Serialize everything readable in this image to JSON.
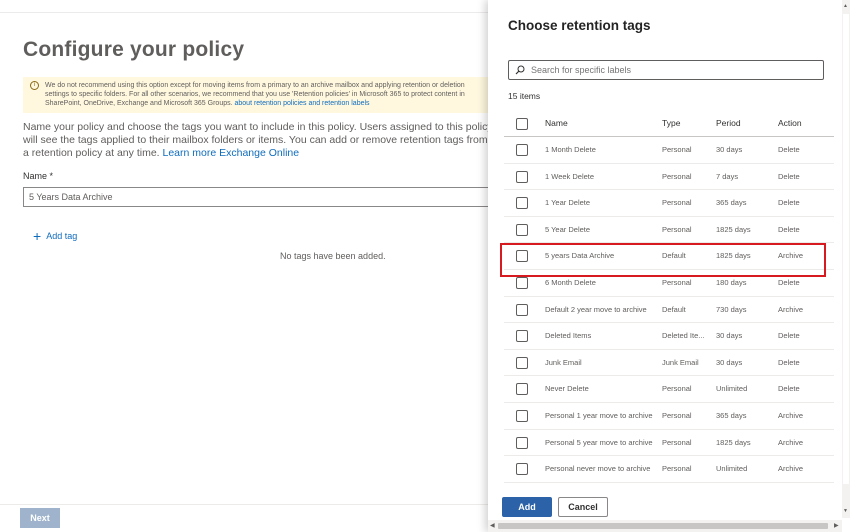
{
  "background": {
    "title": "Configure your policy",
    "warning": "We do not recommend using this option except for moving items from a primary to an archive mailbox and applying retention or deletion settings to specific folders. For all other scenarios, we recommend that you use 'Retention policies' in Microsoft 365 to protect content in SharePoint, OneDrive, Exchange and Microsoft 365 Groups.",
    "warning_link": "about retention policies and retention labels",
    "description": "Name your policy and choose the tags you want to include in this policy. Users assigned to this policy will see the tags applied to their mailbox folders or items. You can add or remove retention tags from a retention policy at any time.",
    "description_link_1": "Learn more",
    "description_link_2": "Exchange Online",
    "name_label": "Name *",
    "name_value": "5 Years Data Archive",
    "add_tag": "Add tag",
    "no_tags": "No tags have been added.",
    "next_button": "Next"
  },
  "panel": {
    "title": "Choose retention tags",
    "search_placeholder": "Search for specific labels",
    "count": "15 items",
    "headers": {
      "name": "Name",
      "type": "Type",
      "period": "Period",
      "action": "Action"
    },
    "rows": [
      {
        "name": "1 Month Delete",
        "type": "Personal",
        "period": "30 days",
        "action": "Delete"
      },
      {
        "name": "1 Week Delete",
        "type": "Personal",
        "period": "7 days",
        "action": "Delete"
      },
      {
        "name": "1 Year Delete",
        "type": "Personal",
        "period": "365 days",
        "action": "Delete"
      },
      {
        "name": "5 Year Delete",
        "type": "Personal",
        "period": "1825 days",
        "action": "Delete"
      },
      {
        "name": "5 years Data Archive",
        "type": "Default",
        "period": "1825 days",
        "action": "Archive"
      },
      {
        "name": "6 Month Delete",
        "type": "Personal",
        "period": "180 days",
        "action": "Delete"
      },
      {
        "name": "Default 2 year move to archive",
        "type": "Default",
        "period": "730 days",
        "action": "Archive"
      },
      {
        "name": "Deleted Items",
        "type": "Deleted Ite...",
        "period": "30 days",
        "action": "Delete"
      },
      {
        "name": "Junk Email",
        "type": "Junk Email",
        "period": "30 days",
        "action": "Delete"
      },
      {
        "name": "Never Delete",
        "type": "Personal",
        "period": "Unlimited",
        "action": "Delete"
      },
      {
        "name": "Personal 1 year move to archive",
        "type": "Personal",
        "period": "365 days",
        "action": "Archive"
      },
      {
        "name": "Personal 5 year move to archive",
        "type": "Personal",
        "period": "1825 days",
        "action": "Archive"
      },
      {
        "name": "Personal never move to archive",
        "type": "Personal",
        "period": "Unlimited",
        "action": "Archive"
      }
    ],
    "add_button": "Add",
    "cancel_button": "Cancel"
  },
  "colors": {
    "accent": "#2b62a8",
    "link": "#0f6cbd",
    "highlight": "#d71920",
    "warning_bg": "#fff8df"
  }
}
